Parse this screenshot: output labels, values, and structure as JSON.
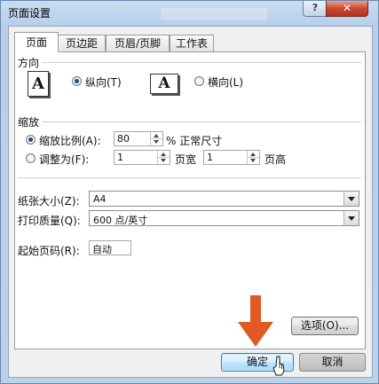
{
  "window": {
    "title": "页面设置",
    "help_label": "?",
    "close_label": "✕"
  },
  "tabs": [
    {
      "label": "页面",
      "active": true
    },
    {
      "label": "页边距",
      "active": false
    },
    {
      "label": "页眉/页脚",
      "active": false
    },
    {
      "label": "工作表",
      "active": false
    }
  ],
  "orientation": {
    "heading": "方向",
    "portrait_icon_letter": "A",
    "portrait_label": "纵向(T)",
    "portrait_selected": true,
    "landscape_icon_letter": "A",
    "landscape_label": "横向(L)",
    "landscape_selected": false
  },
  "scaling": {
    "heading": "缩放",
    "adjust_label": "缩放比例(A):",
    "adjust_value": "80",
    "adjust_suffix": "% 正常尺寸",
    "adjust_selected": true,
    "fit_label": "调整为(F):",
    "fit_selected": false,
    "fit_wide_value": "1",
    "fit_wide_suffix": "页宽",
    "fit_tall_value": "1",
    "fit_tall_suffix": "页高"
  },
  "paper_size": {
    "label": "纸张大小(Z):",
    "value": "A4"
  },
  "print_quality": {
    "label": "打印质量(Q):",
    "value": "600 点/英寸"
  },
  "first_page_number": {
    "label": "起始页码(R):",
    "value": "自动"
  },
  "buttons": {
    "options_label": "选项(O)...",
    "ok_label": "确定",
    "cancel_label": "取消"
  },
  "colors": {
    "arrow": "#e05a26",
    "selection": "#204a8a"
  },
  "icons": {
    "annotation_arrow": "down-arrow-icon",
    "pointer": "mouse-cursor-icon"
  }
}
